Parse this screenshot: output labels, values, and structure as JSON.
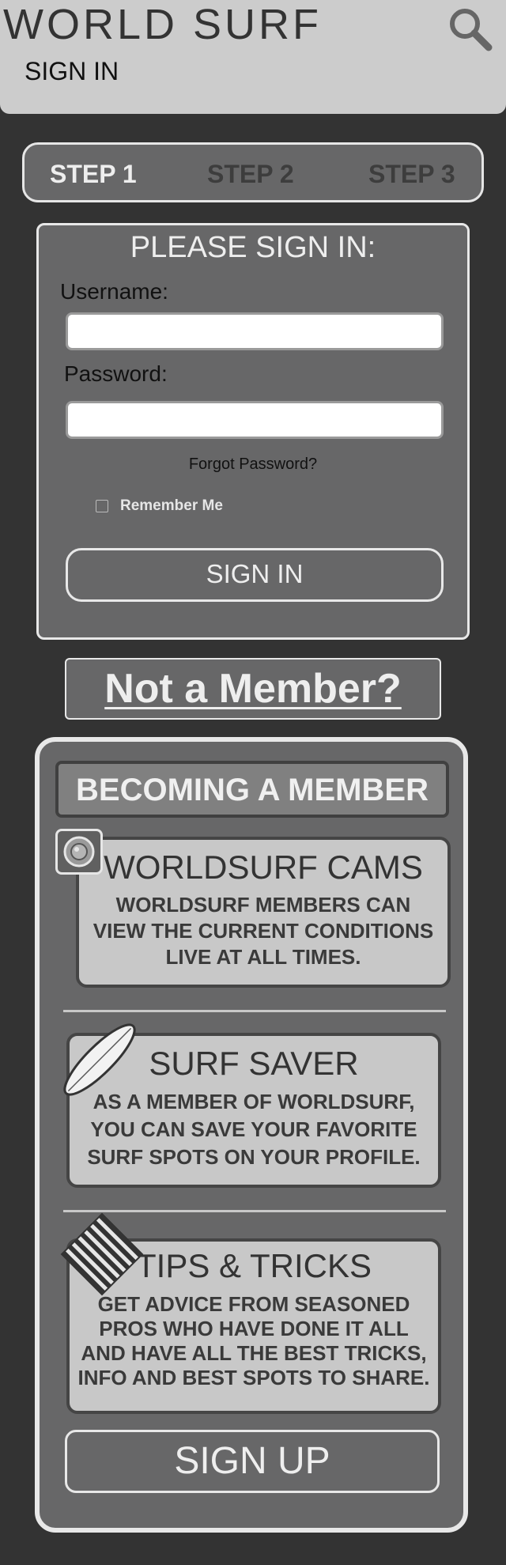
{
  "header": {
    "app_title": "WORLD SURF",
    "page_subtitle": "SIGN IN",
    "search_icon": "search-icon"
  },
  "steps": {
    "current": 1,
    "items": [
      {
        "label": "STEP 1",
        "active": true
      },
      {
        "label": "STEP 2",
        "active": false
      },
      {
        "label": "STEP 3",
        "active": false
      }
    ]
  },
  "signin": {
    "heading": "PLEASE SIGN IN:",
    "username_label": "Username:",
    "username_value": "",
    "password_label": "Password:",
    "password_value": "",
    "forgot_link": "Forgot Password?",
    "remember_label": "Remember Me",
    "remember_checked": false,
    "submit_label": "SIGN IN"
  },
  "not_member": {
    "link": "Not a Member?"
  },
  "membership": {
    "heading": "BECOMING A MEMBER",
    "features": [
      {
        "icon": "camera-icon",
        "title": "WORLDSURF CAMS",
        "lines": [
          "WORLDSURF MEMBERS CAN",
          "VIEW THE CURRENT CONDITIONS",
          "LIVE AT ALL TIMES."
        ]
      },
      {
        "icon": "surfboard-icon",
        "title": "SURF SAVER",
        "lines": [
          "AS A MEMBER OF WORLDSURF,",
          "YOU CAN SAVE YOUR FAVORITE",
          "SURF SPOTS ON YOUR PROFILE."
        ]
      },
      {
        "icon": "striped-tips-icon",
        "title": "TIPS & TRICKS",
        "lines": [
          "GET ADVICE FROM SEASONED",
          "PROS WHO HAVE DONE IT ALL",
          "AND HAVE ALL THE BEST TRICKS,",
          "INFO AND BEST SPOTS TO SHARE."
        ]
      }
    ],
    "signup_label": "SIGN UP"
  },
  "colors": {
    "background": "#333333",
    "header": "#cccccc",
    "panel": "#676768",
    "panel_border": "#e8e8e8",
    "feature_box": "#c8c8c8",
    "active_step": "#eeeeee",
    "inactive_step": "#3d3d3d"
  }
}
